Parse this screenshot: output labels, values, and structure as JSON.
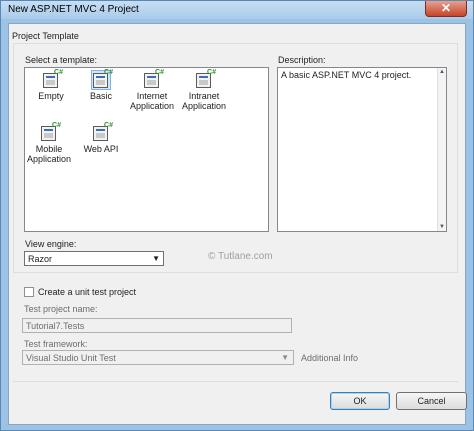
{
  "window": {
    "title": "New ASP.NET MVC 4 Project",
    "close_symbol": "✕"
  },
  "project_template": {
    "group_label": "Project Template",
    "select_label": "Select a template:",
    "templates": [
      {
        "label": "Empty",
        "selected": false
      },
      {
        "label": "Basic",
        "selected": true
      },
      {
        "label": "Internet Application",
        "selected": false
      },
      {
        "label": "Intranet Application",
        "selected": false
      },
      {
        "label": "Mobile Application",
        "selected": false
      },
      {
        "label": "Web API",
        "selected": false
      }
    ],
    "icon_badge": "C#",
    "description_label": "Description:",
    "description_text": "A basic ASP.NET MVC 4 project."
  },
  "view_engine": {
    "label": "View engine:",
    "value": "Razor"
  },
  "watermark": "© Tutlane.com",
  "unit_test": {
    "checkbox_label": "Create a unit test project",
    "checked": false,
    "project_name_label": "Test project name:",
    "project_name_value": "Tutorial7.Tests",
    "framework_label": "Test framework:",
    "framework_value": "Visual Studio Unit Test",
    "additional_info": "Additional Info"
  },
  "buttons": {
    "ok": "OK",
    "cancel": "Cancel"
  },
  "icons": {
    "scroll_up": "▲",
    "scroll_down": "▼",
    "dropdown": "▼"
  },
  "colors": {
    "titlebar": "#a9cbe9",
    "dialog_bg": "#f0f0f0",
    "selection": "#cfe6fb"
  }
}
